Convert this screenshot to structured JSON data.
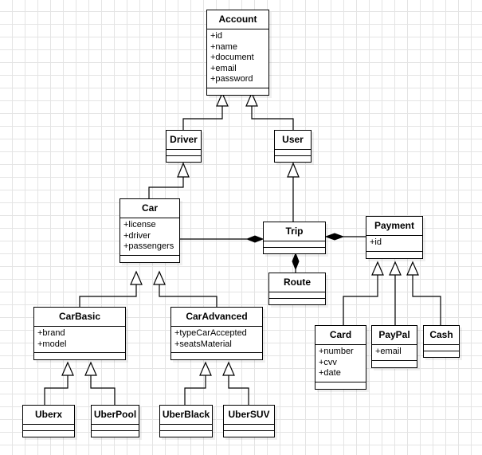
{
  "diagram": {
    "type": "UML class diagram",
    "classes": {
      "account": {
        "name": "Account",
        "attributes": [
          "+id",
          "+name",
          "+document",
          "+email",
          "+password"
        ]
      },
      "driver": {
        "name": "Driver",
        "attributes": []
      },
      "user": {
        "name": "User",
        "attributes": []
      },
      "car": {
        "name": "Car",
        "attributes": [
          "+license",
          "+driver",
          "+passengers"
        ]
      },
      "trip": {
        "name": "Trip",
        "attributes": []
      },
      "route": {
        "name": "Route",
        "attributes": []
      },
      "payment": {
        "name": "Payment",
        "attributes": [
          "+id"
        ]
      },
      "car_basic": {
        "name": "CarBasic",
        "attributes": [
          "+brand",
          "+model"
        ]
      },
      "car_advanced": {
        "name": "CarAdvanced",
        "attributes": [
          "+typeCarAccepted",
          "+seatsMaterial"
        ]
      },
      "card": {
        "name": "Card",
        "attributes": [
          "+number",
          "+cvv",
          "+date"
        ]
      },
      "paypal": {
        "name": "PayPal",
        "attributes": [
          "+email"
        ]
      },
      "cash": {
        "name": "Cash",
        "attributes": []
      },
      "uberx": {
        "name": "Uberx",
        "attributes": []
      },
      "uberpool": {
        "name": "UberPool",
        "attributes": []
      },
      "uberblack": {
        "name": "UberBlack",
        "attributes": []
      },
      "ubersuv": {
        "name": "UberSUV",
        "attributes": []
      }
    },
    "relationships": [
      {
        "type": "generalization",
        "from": "Driver",
        "to": "Account"
      },
      {
        "type": "generalization",
        "from": "User",
        "to": "Account"
      },
      {
        "type": "generalization",
        "from": "Car",
        "to": "Driver"
      },
      {
        "type": "generalization",
        "from": "Trip",
        "to": "User"
      },
      {
        "type": "composition",
        "whole": "Trip",
        "part": "Car"
      },
      {
        "type": "composition",
        "whole": "Trip",
        "part": "Payment"
      },
      {
        "type": "composition",
        "whole": "Trip",
        "part": "Route"
      },
      {
        "type": "generalization",
        "from": "CarBasic",
        "to": "Car"
      },
      {
        "type": "generalization",
        "from": "CarAdvanced",
        "to": "Car"
      },
      {
        "type": "generalization",
        "from": "Uberx",
        "to": "CarBasic"
      },
      {
        "type": "generalization",
        "from": "UberPool",
        "to": "CarBasic"
      },
      {
        "type": "generalization",
        "from": "UberBlack",
        "to": "CarAdvanced"
      },
      {
        "type": "generalization",
        "from": "UberSUV",
        "to": "CarAdvanced"
      },
      {
        "type": "generalization",
        "from": "Card",
        "to": "Payment"
      },
      {
        "type": "generalization",
        "from": "PayPal",
        "to": "Payment"
      },
      {
        "type": "generalization",
        "from": "Cash",
        "to": "Payment"
      }
    ]
  }
}
